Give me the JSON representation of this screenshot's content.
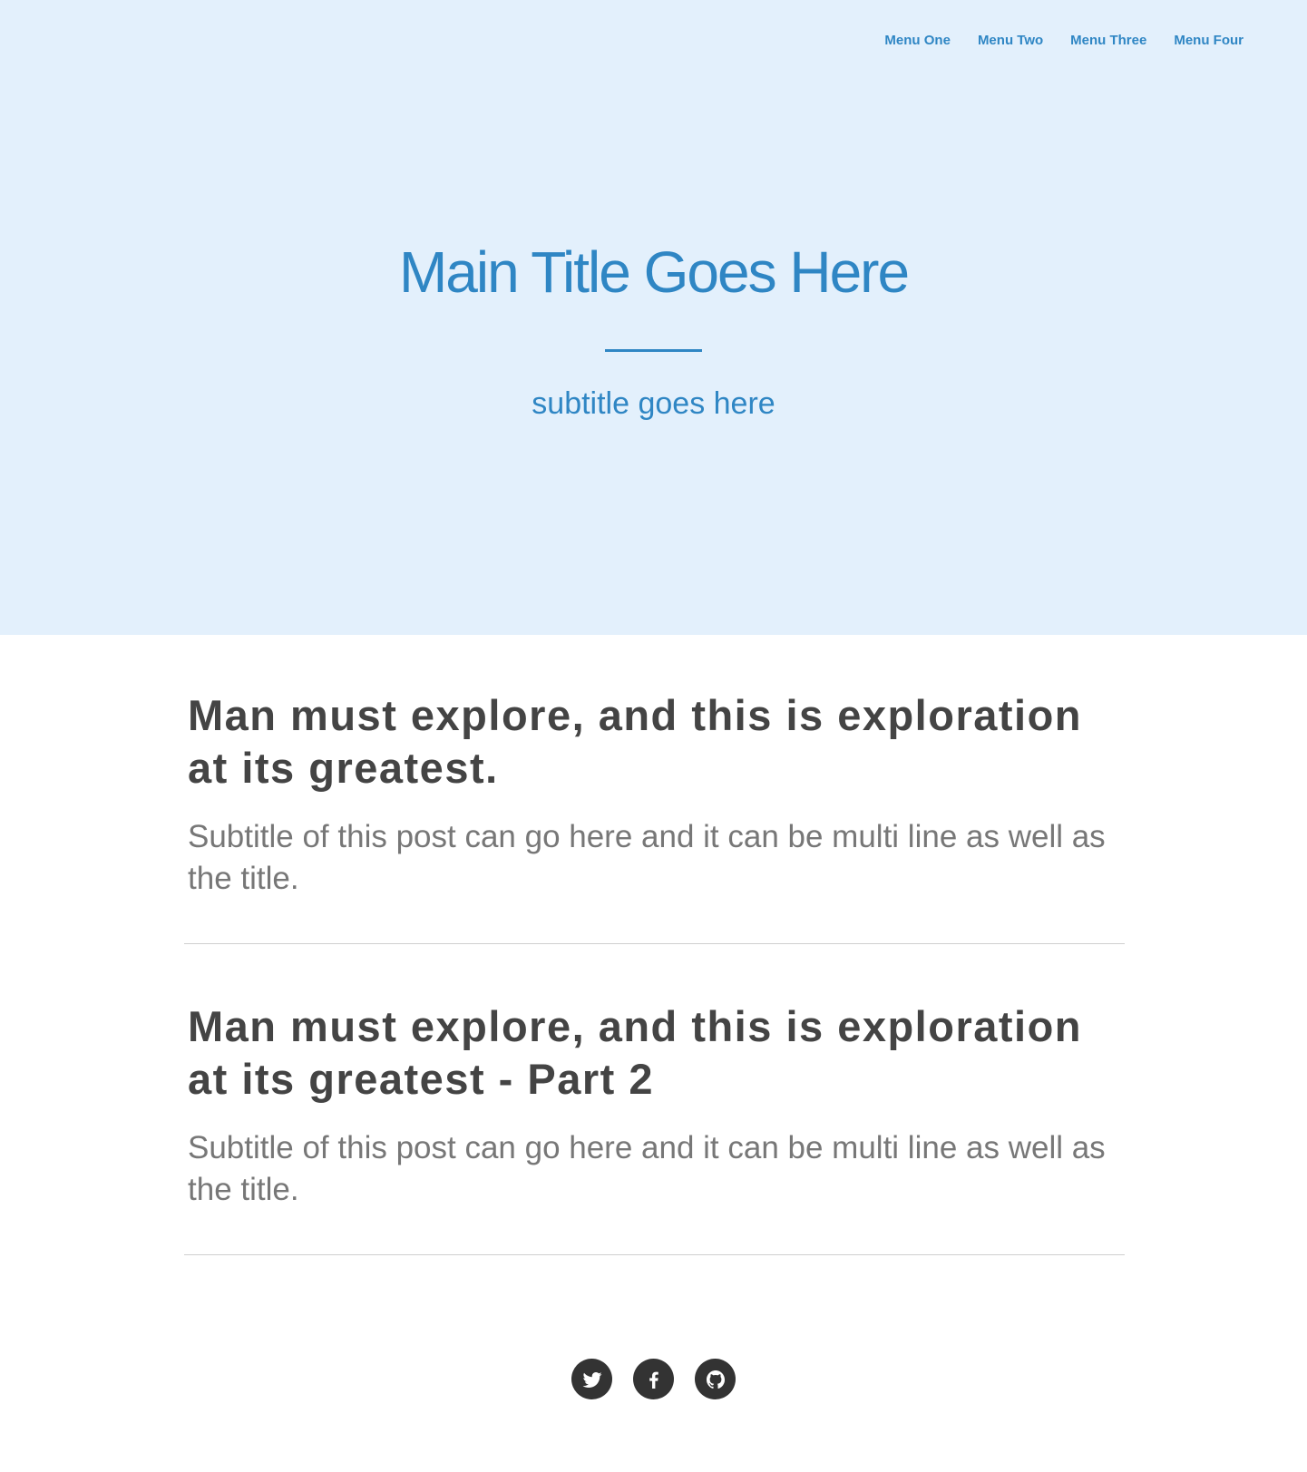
{
  "nav": {
    "items": [
      {
        "label": "Menu One"
      },
      {
        "label": "Menu Two"
      },
      {
        "label": "Menu Three"
      },
      {
        "label": "Menu Four"
      }
    ]
  },
  "hero": {
    "title": "Main Title Goes Here",
    "subtitle": "subtitle goes here"
  },
  "posts": [
    {
      "title": "Man must explore, and this is exploration at its greatest.",
      "subtitle": "Subtitle of this post can go here and it can be multi line as well as the title."
    },
    {
      "title": "Man must explore, and this is exploration at its greatest - Part 2",
      "subtitle": "Subtitle of this post can go here and it can be multi line as well as the title."
    }
  ],
  "social": {
    "icons": [
      "twitter-icon",
      "facebook-icon",
      "github-icon"
    ]
  },
  "colors": {
    "accent": "#2f86c4",
    "hero_bg": "#e3f0fc",
    "heading": "#444444",
    "muted": "#777777",
    "social_bg": "#333333"
  }
}
